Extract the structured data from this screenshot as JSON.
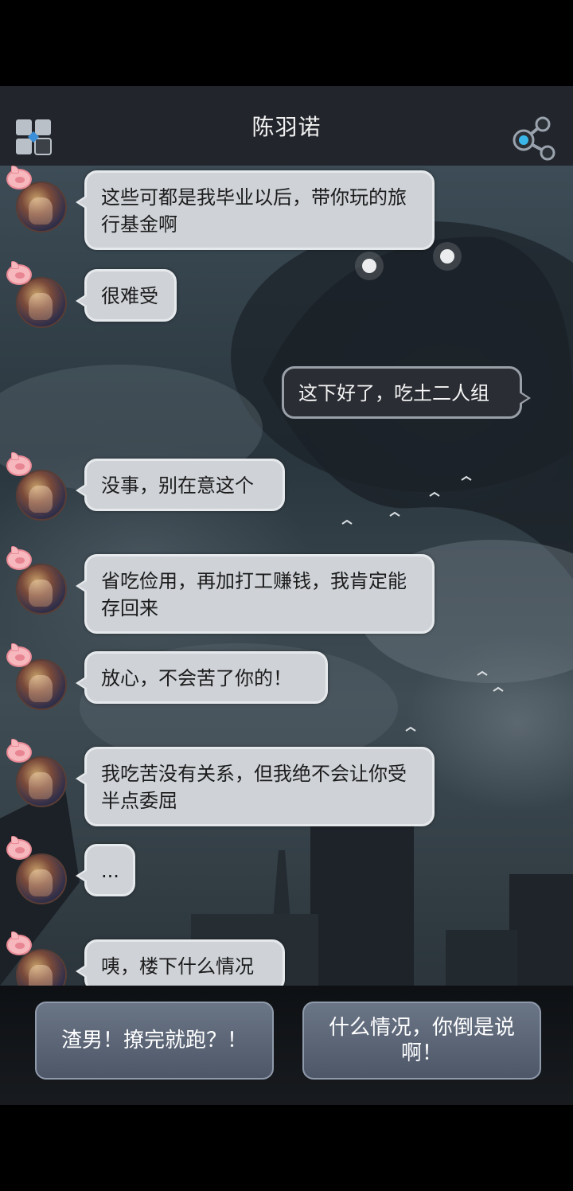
{
  "header": {
    "title": "陈羽诺",
    "menu_icon": "grid-menu-icon",
    "share_icon": "share-icon"
  },
  "messages": [
    {
      "side": "left",
      "text": "这些可都是我毕业以后，带你玩的旅行基金啊"
    },
    {
      "side": "left",
      "text": "很难受"
    },
    {
      "side": "right",
      "text": "这下好了，吃土二人组"
    },
    {
      "side": "left",
      "text": "没事，别在意这个"
    },
    {
      "side": "left",
      "text": "省吃俭用，再加打工赚钱，我肯定能存回来"
    },
    {
      "side": "left",
      "text": "放心，不会苦了你的！"
    },
    {
      "side": "left",
      "text": "我吃苦没有关系，但我绝不会让你受半点委屈"
    },
    {
      "side": "left",
      "text": "..."
    },
    {
      "side": "left",
      "text": "咦，楼下什么情况"
    }
  ],
  "choices": [
    {
      "label": "渣男！撩完就跑？！"
    },
    {
      "label": "什么情况，你倒是说啊！"
    }
  ],
  "colors": {
    "header_bg": "#22252b",
    "left_bubble_bg": "#cfd3d8",
    "right_bubble_bg": "#2a2d33",
    "choice_bg": "#5d6778"
  }
}
